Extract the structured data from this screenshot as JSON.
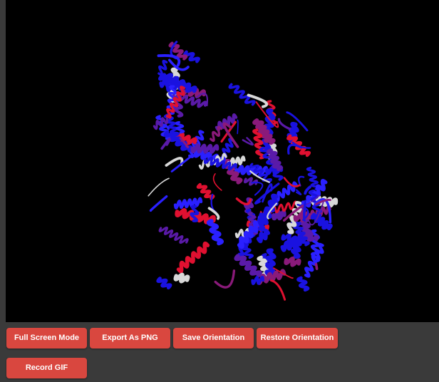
{
  "viewer": {
    "background": "#000000",
    "ribbon_colors": [
      "#1a12e0",
      "#2a20ff",
      "#5a1aa8",
      "#8a1a7a",
      "#e01030",
      "#d8d8d8"
    ]
  },
  "buttons": {
    "full_screen": "Full Screen Mode",
    "export_png": "Export As PNG",
    "save_orientation": "Save Orientation",
    "restore_orientation": "Restore Orientation",
    "record_gif": "Record GIF"
  },
  "button_color": "#d9473f"
}
